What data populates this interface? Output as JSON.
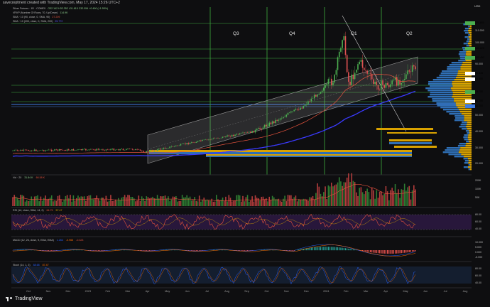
{
  "header": {
    "author_line": "saverzeptment created with TradingView.com, May 17, 2024 15:26 UTC+2",
    "currency": "USD"
  },
  "legend": {
    "symbol_line": "Silver Futures · 1D · COMEX",
    "symbol_values": "O32.142 H32.352 L31.615 C32.054 +0.490 (+1.55%)",
    "vrvp_line": "VRVP (Number Of Rows, 70, Up/Down)",
    "vrvp_value": "114.9K",
    "sma1_line": "SMA · 10 (90, close, 0, SMA, 90)",
    "sma1_value": "27.209",
    "sma2_line": "SMA · 10 (200, close, 0, SMA, 200)",
    "sma2_value": "25.772"
  },
  "quarters": [
    "Q3",
    "Q4",
    "Q1",
    "Q2"
  ],
  "price_axis": [
    "120.000",
    "110.000",
    "100.000",
    "90.000",
    "80.000",
    "70.000",
    "60.000",
    "50.000",
    "40.000",
    "30.000",
    "20.000"
  ],
  "price_tags": [
    {
      "text": "121.800",
      "color": "#4caf50"
    },
    {
      "text": "103.625",
      "color": "#4caf50"
    },
    {
      "text": "102.450",
      "color": "#4caf50"
    },
    {
      "text": "91.815",
      "color": "#ffffff"
    },
    {
      "text": "81.450",
      "color": "#ffffff"
    },
    {
      "text": "73.750",
      "color": "#4caf50"
    },
    {
      "text": "66.750",
      "color": "#ffffff"
    },
    {
      "text": "64.200",
      "color": "#3f7be0"
    }
  ],
  "x_axis": [
    "Oct",
    "Nov",
    "Dec",
    "2023",
    "Feb",
    "Mar",
    "Apr",
    "May",
    "Jun",
    "Jul",
    "Aug",
    "Sep",
    "Oct",
    "Nov",
    "Dec",
    "2024",
    "Feb",
    "Mar",
    "Apr",
    "May",
    "Jun",
    "Jul",
    "Aug"
  ],
  "panes": {
    "volume": {
      "label": "Vol · 20",
      "value": "31.84 K",
      "value2": "66.58 K",
      "axis": [
        "200K",
        "100K",
        "50K",
        "0"
      ]
    },
    "rsi": {
      "label": "RSI (14, close, SMA, 14, 2)",
      "value": "64.75",
      "value2": "57.47",
      "axis": [
        "80.00",
        "60.00",
        "40.00",
        "20.00"
      ]
    },
    "macd": {
      "label": "MACD (12, 26, close, 9, EMA, EMA)",
      "value": "1.264",
      "value2": "-0.966",
      "value3": "-0.323",
      "axis": [
        "10.000",
        "5.000",
        "0.000",
        "-5.000",
        "-10.000"
      ]
    },
    "stoch": {
      "label": "Stoch (14, 1, 3)",
      "value": "88.68",
      "value2": "87.47",
      "axis": [
        "80.00",
        "60.00",
        "40.00",
        "20.00"
      ]
    }
  },
  "colors": {
    "background": "#0e0e10",
    "vertical_lines": "#3fae3f",
    "channel": "#8a8a8a",
    "sma90": "#e5533d",
    "sma200": "#3a3aff",
    "vrvp_up": "#2f6fb5",
    "vrvp_down": "#d9a200",
    "rsi_band": "#3b1f55"
  },
  "footer": {
    "brand": "TradingView"
  }
}
